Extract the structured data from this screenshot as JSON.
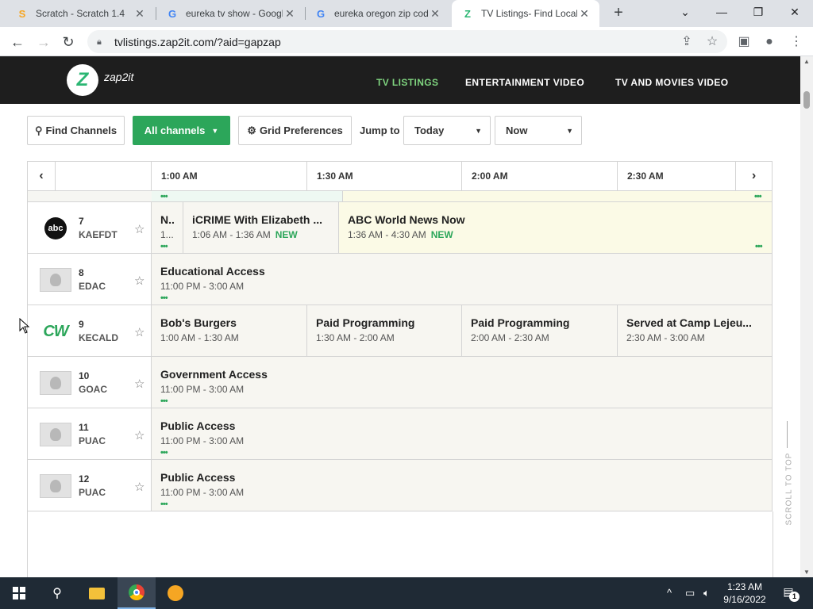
{
  "browser": {
    "tabs": [
      {
        "title": "Scratch - Scratch 1.4",
        "favicon": "scratch-icon",
        "favicon_glyph": "S",
        "favicon_color": "#f6a623",
        "active": false
      },
      {
        "title": "eureka tv show - Google",
        "favicon": "google-icon",
        "favicon_glyph": "G",
        "favicon_color": "#4285f4",
        "active": false
      },
      {
        "title": "eureka oregon zip code",
        "favicon": "google-icon",
        "favicon_glyph": "G",
        "favicon_color": "#4285f4",
        "active": false
      },
      {
        "title": "TV Listings- Find Local",
        "favicon": "zap2it-icon",
        "favicon_glyph": "Z",
        "favicon_color": "#2bb673",
        "active": true
      }
    ],
    "url": "tvlistings.zap2it.com/?aid=gapzap"
  },
  "site": {
    "logo_letter": "Z",
    "logo_text": "zap2it",
    "nav": [
      {
        "label": "TV LISTINGS",
        "active": true
      },
      {
        "label": "ENTERTAINMENT VIDEO",
        "active": false
      },
      {
        "label": "TV AND MOVIES VIDEO",
        "active": false
      }
    ]
  },
  "filters": {
    "find_channels": "Find Channels",
    "all_channels": "All channels",
    "grid_preferences": "Grid Preferences",
    "jump_to": "Jump to",
    "day": "Today",
    "time": "Now"
  },
  "grid": {
    "time_slots": [
      "1:00 AM",
      "1:30 AM",
      "2:00 AM",
      "2:30 AM"
    ],
    "channels": [
      {
        "number": "7",
        "callsign": "KAEFDT",
        "logo": "abc-logo",
        "logo_text": "abc",
        "programs": [
          {
            "title": "N..",
            "time": "1...",
            "new": false,
            "dots": true,
            "highlight": false
          },
          {
            "title": "iCRIME With Elizabeth ...",
            "time": "1:06 AM - 1:36 AM",
            "new": true,
            "dots": false,
            "highlight": false
          },
          {
            "title": "ABC World News Now",
            "time": "1:36 AM - 4:30 AM",
            "new": true,
            "dots": true,
            "highlight": true
          }
        ]
      },
      {
        "number": "8",
        "callsign": "EDAC",
        "logo": "placeholder-logo",
        "logo_text": "",
        "programs": [
          {
            "title": "Educational Access",
            "time": "11:00 PM - 3:00 AM",
            "new": false,
            "dots": true,
            "highlight": false
          }
        ]
      },
      {
        "number": "9",
        "callsign": "KECALD",
        "logo": "cw-logo",
        "logo_text": "CW",
        "programs": [
          {
            "title": "Bob's Burgers",
            "time": "1:00 AM - 1:30 AM",
            "new": false,
            "dots": false,
            "highlight": false
          },
          {
            "title": "Paid Programming",
            "time": "1:30 AM - 2:00 AM",
            "new": false,
            "dots": false,
            "highlight": false
          },
          {
            "title": "Paid Programming",
            "time": "2:00 AM - 2:30 AM",
            "new": false,
            "dots": false,
            "highlight": false
          },
          {
            "title": "Served at Camp Lejeu...",
            "time": "2:30 AM - 3:00 AM",
            "new": false,
            "dots": false,
            "highlight": false
          }
        ]
      },
      {
        "number": "10",
        "callsign": "GOAC",
        "logo": "placeholder-logo",
        "logo_text": "",
        "programs": [
          {
            "title": "Government Access",
            "time": "11:00 PM - 3:00 AM",
            "new": false,
            "dots": true,
            "highlight": false
          }
        ]
      },
      {
        "number": "11",
        "callsign": "PUAC",
        "logo": "placeholder-logo",
        "logo_text": "",
        "programs": [
          {
            "title": "Public Access",
            "time": "11:00 PM - 3:00 AM",
            "new": false,
            "dots": true,
            "highlight": false
          }
        ]
      },
      {
        "number": "12",
        "callsign": "PUAC",
        "logo": "placeholder-logo",
        "logo_text": "",
        "programs": [
          {
            "title": "Public Access",
            "time": "11:00 PM - 3:00 AM",
            "new": false,
            "dots": true,
            "highlight": false
          }
        ]
      }
    ],
    "new_label": "NEW",
    "scroll_to_top": "SCROLL TO TOP"
  },
  "taskbar": {
    "time": "1:23 AM",
    "date": "9/16/2022",
    "notifications": "1"
  },
  "colors": {
    "accent_green": "#2ca65a",
    "header_bg": "#1e1e1e",
    "nav_active": "#7fd47f"
  }
}
